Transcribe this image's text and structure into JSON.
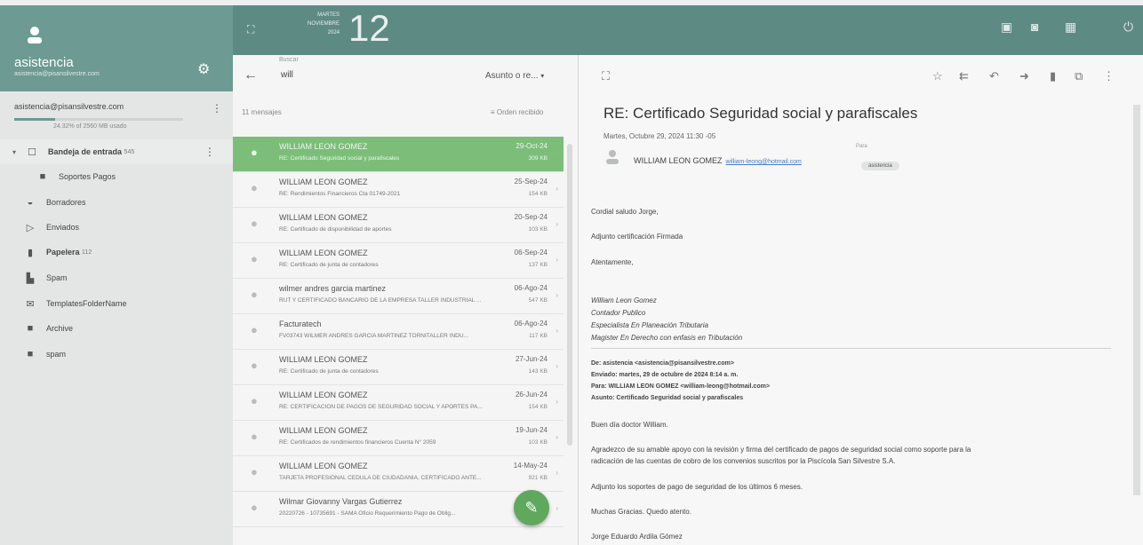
{
  "account": {
    "name": "asistencia",
    "email_small": "asistencia@pisansilvestre.com"
  },
  "quota": {
    "email": "asistencia@pisansilvestre.com",
    "text": "24.32% of 2560 MB usado",
    "fraction": 0.24
  },
  "folders": [
    {
      "label": "Bandeja de entrada",
      "count": "545",
      "icon": "inbox-icon"
    },
    {
      "label": "Soportes Pagos",
      "count": "",
      "icon": "folder-icon"
    },
    {
      "label": "Borradores",
      "count": "",
      "icon": "drafts-icon"
    },
    {
      "label": "Enviados",
      "count": "",
      "icon": "sent-icon"
    },
    {
      "label": "Papelera",
      "count": "112",
      "icon": "trash-icon"
    },
    {
      "label": "Spam",
      "count": "",
      "icon": "spam-icon"
    },
    {
      "label": "TemplatesFolderName",
      "count": "",
      "icon": "template-icon"
    },
    {
      "label": "Archive",
      "count": "",
      "icon": "folder-icon"
    },
    {
      "label": "spam",
      "count": "",
      "icon": "folder-icon"
    }
  ],
  "topbar": {
    "weekday": "MARTES",
    "month": "NOVIEMBRE",
    "year": "2024",
    "day": "12"
  },
  "search": {
    "label": "Buscar",
    "value": "will",
    "scope": "Asunto o re..."
  },
  "list": {
    "count": "11 mensajes",
    "sort": "Orden recibido"
  },
  "messages": [
    {
      "from": "WILLIAM LEON GOMEZ",
      "subject": "RE: Certificado Seguridad social y parafiscales",
      "date": "29-Oct-24",
      "size": "309 KB",
      "selected": true
    },
    {
      "from": "WILLIAM LEON GOMEZ",
      "subject": "RE: Rendimientos Financieros Cta 01749-2021",
      "date": "25-Sep-24",
      "size": "154 KB",
      "selected": false
    },
    {
      "from": "WILLIAM LEON GOMEZ",
      "subject": "RE: Certificado de disponibilidad de aportes",
      "date": "20-Sep-24",
      "size": "103 KB",
      "selected": false
    },
    {
      "from": "WILLIAM LEON GOMEZ",
      "subject": "RE: Certificado de junta de contadores",
      "date": "06-Sep-24",
      "size": "137 KB",
      "selected": false
    },
    {
      "from": "wilmer andres garcia martinez",
      "subject": "RUT Y CERTIFICADO BANCARIO DE LA EMPRESA TALLER INDUSTRIAL ...",
      "date": "06-Ago-24",
      "size": "547 KB",
      "selected": false
    },
    {
      "from": "Facturatech",
      "subject": "FV03743 WILMER ANDRES GARCIA MARTINEZ TORNITALLER INDU...",
      "date": "06-Ago-24",
      "size": "117 KB",
      "selected": false
    },
    {
      "from": "WILLIAM LEON GOMEZ",
      "subject": "RE: Certificado de junta de contadores",
      "date": "27-Jun-24",
      "size": "143 KB",
      "selected": false
    },
    {
      "from": "WILLIAM LEON GOMEZ",
      "subject": "RE: CERTIFICACION DE PAGOS DE SEGURIDAD SOCIAL Y APORTES PA...",
      "date": "26-Jun-24",
      "size": "154 KB",
      "selected": false
    },
    {
      "from": "WILLIAM LEON GOMEZ",
      "subject": "RE: Certificados de rendimientos financieros Cuenta N° 2059",
      "date": "19-Jun-24",
      "size": "103 KB",
      "selected": false
    },
    {
      "from": "WILLIAM LEON GOMEZ",
      "subject": "TARJETA PROFESIONAL CEDULA DE CIUDADANIA, CERTIFICADO ANTE...",
      "date": "14-May-24",
      "size": "921 KB",
      "selected": false
    },
    {
      "from": "Wilmar Giovanny Vargas Gutierrez",
      "subject": "20220726 - 10735691 - SAMA Oficio Requerimiento Pago de Oblig...",
      "date": "",
      "size": "",
      "selected": false
    }
  ],
  "reader": {
    "subject": "RE: Certificado Seguridad social y parafiscales",
    "date": "Martes, Octubre 29, 2024 11:30 -05",
    "para_label": "Para",
    "from_name": "WILLIAM LEON GOMEZ",
    "from_email": "william-leong@hotmail.com",
    "to": "asistencia",
    "greeting": "Cordial saludo Jorge,",
    "line1": "Adjunto certificación Firmada",
    "closing": "Atentamente,",
    "sig1": "William Leon Gomez",
    "sig2": "Contador Publico",
    "sig3": "Especialista En Planeación Tributaria",
    "sig4": "Magister En Derecho con enfasis en Tributación",
    "q_de": "De: asistencia <asistencia@pisansilvestre.com>",
    "q_enviado": "Enviado: martes, 29 de octubre de 2024 8:14 a. m.",
    "q_para": "Para: WILLIAM LEON GOMEZ <william-leong@hotmail.com>",
    "q_asunto": "Asunto: Certificado Seguridad social y parafiscales",
    "body1": "Buen día doctor William.",
    "body2a": "Agradezco de su amable apoyo con la revisión y firma del certificado de pagos de seguridad social como soporte para la",
    "body2b": "radicación de las cuentas de cobro de los convenios suscritos por la Piscícola San Silvestre S.A.",
    "body3": "Adjunto los soportes de pago de seguridad de los últimos 6 meses.",
    "body4": "Muchas Gracias. Quedo atento.",
    "body5": "Jorge Eduardo Ardila Gómez"
  },
  "colors": {
    "header": "#6d9a92",
    "topbar": "#5e8a84",
    "selected": "#7cbd7a",
    "fab": "#5fa85e"
  }
}
